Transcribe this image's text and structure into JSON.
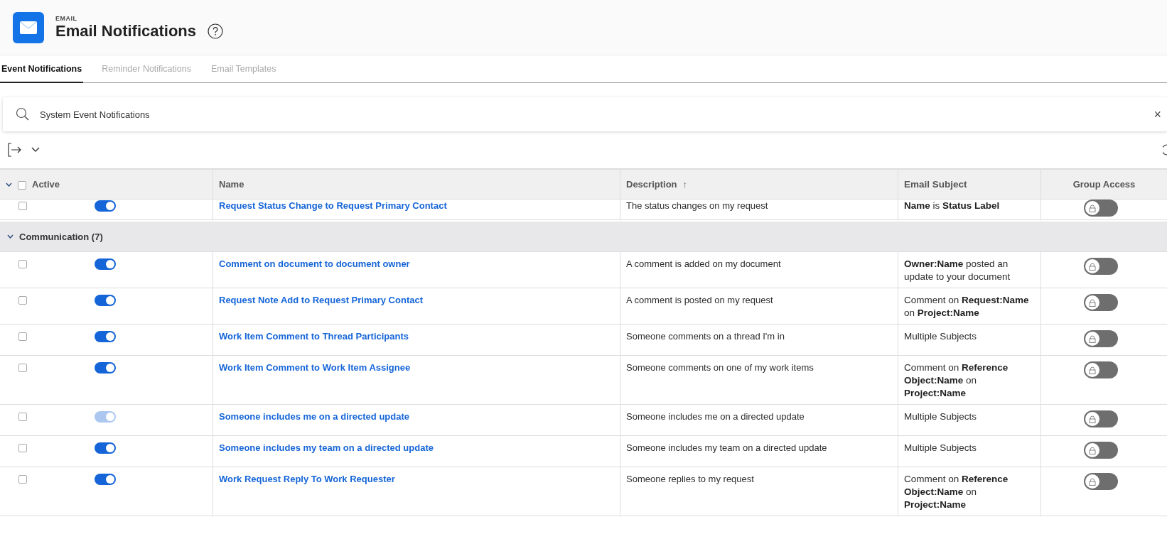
{
  "header": {
    "eyebrow": "EMAIL",
    "title": "Email Notifications"
  },
  "tabs": [
    {
      "label": "Event Notifications",
      "selected": true
    },
    {
      "label": "Reminder Notifications",
      "selected": false
    },
    {
      "label": "Email Templates",
      "selected": false
    }
  ],
  "search": {
    "value": "System Event Notifications",
    "clear": "×"
  },
  "table": {
    "select_all_checked": false,
    "columns": [
      {
        "label": "Active"
      },
      {
        "label": "Name"
      },
      {
        "label": "Description",
        "sort": "↑"
      },
      {
        "label": "Email Subject"
      },
      {
        "label": "Group Access"
      }
    ],
    "groups": [
      {
        "rows": [
          {
            "checked": false,
            "active": true,
            "disabled": false,
            "name": "Request Status Change to Request Primary Contact",
            "description": "The status changes on my request",
            "subject": "**Name** is **Status Label**",
            "group_access": false
          }
        ]
      },
      {
        "label": "Communication (7)",
        "expanded": true,
        "rows": [
          {
            "checked": false,
            "active": true,
            "disabled": false,
            "name": "Comment on document to document owner",
            "description": "A comment is added on my document",
            "subject": "**Owner:Name** posted an update to your document",
            "group_access": false
          },
          {
            "checked": false,
            "active": true,
            "disabled": false,
            "name": "Request Note Add to Request Primary Contact",
            "description": "A comment is posted on my request",
            "subject": "Comment on **Request:Name** on **Project:Name**",
            "group_access": false
          },
          {
            "checked": false,
            "active": true,
            "disabled": false,
            "name": "Work Item Comment to Thread Participants",
            "description": "Someone comments on a thread I'm in",
            "subject": "Multiple Subjects",
            "group_access": false
          },
          {
            "checked": false,
            "active": true,
            "disabled": false,
            "name": "Work Item Comment to Work Item Assignee",
            "description": "Someone comments on one of my work items",
            "subject": "Comment on **Reference Object:Name** on **Project:Name**",
            "group_access": false
          },
          {
            "checked": false,
            "active": true,
            "disabled": true,
            "name": "Someone includes me on a directed update",
            "description": "Someone includes me on a directed update",
            "subject": "Multiple Subjects",
            "group_access": false
          },
          {
            "checked": false,
            "active": true,
            "disabled": false,
            "name": "Someone includes my team on a directed update",
            "description": "Someone includes my team on a directed update",
            "subject": "Multiple Subjects",
            "group_access": false
          },
          {
            "checked": false,
            "active": true,
            "disabled": false,
            "name": "Work Request Reply To Work Requester",
            "description": "Someone replies to my request",
            "subject": "Comment on **Reference Object:Name** on **Project:Name**",
            "group_access": false
          }
        ]
      }
    ]
  }
}
